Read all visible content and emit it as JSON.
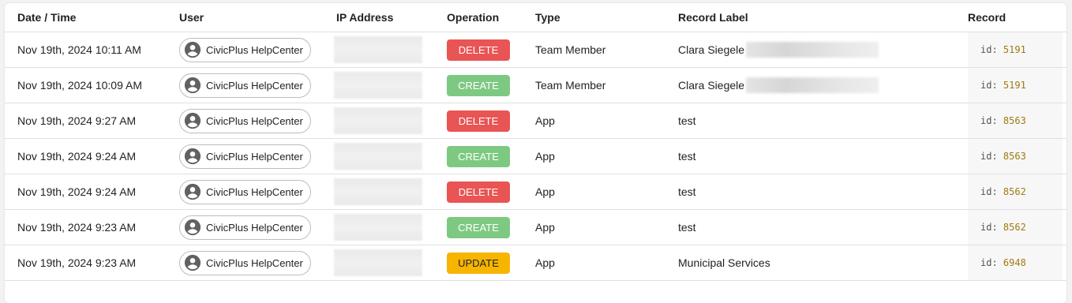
{
  "columns": {
    "date": "Date / Time",
    "user": "User",
    "ip": "IP Address",
    "operation": "Operation",
    "type": "Type",
    "label": "Record Label",
    "record": "Record"
  },
  "colors": {
    "DELETE": "#e85554",
    "CREATE": "#7ec982",
    "UPDATE": "#f7b500"
  },
  "rows": [
    {
      "date": "Nov 19th, 2024 10:11 AM",
      "user": "CivicPlus HelpCenter",
      "operation": "DELETE",
      "type": "Team Member",
      "label": "Clara Siegele",
      "label_redacted": true,
      "record_key": "id:",
      "record_id": "5191"
    },
    {
      "date": "Nov 19th, 2024 10:09 AM",
      "user": "CivicPlus HelpCenter",
      "operation": "CREATE",
      "type": "Team Member",
      "label": "Clara Siegele",
      "label_redacted": true,
      "record_key": "id:",
      "record_id": "5191"
    },
    {
      "date": "Nov 19th, 2024 9:27 AM",
      "user": "CivicPlus HelpCenter",
      "operation": "DELETE",
      "type": "App",
      "label": "test",
      "label_redacted": false,
      "record_key": "id:",
      "record_id": "8563"
    },
    {
      "date": "Nov 19th, 2024 9:24 AM",
      "user": "CivicPlus HelpCenter",
      "operation": "CREATE",
      "type": "App",
      "label": "test",
      "label_redacted": false,
      "record_key": "id:",
      "record_id": "8563"
    },
    {
      "date": "Nov 19th, 2024 9:24 AM",
      "user": "CivicPlus HelpCenter",
      "operation": "DELETE",
      "type": "App",
      "label": "test",
      "label_redacted": false,
      "record_key": "id:",
      "record_id": "8562"
    },
    {
      "date": "Nov 19th, 2024 9:23 AM",
      "user": "CivicPlus HelpCenter",
      "operation": "CREATE",
      "type": "App",
      "label": "test",
      "label_redacted": false,
      "record_key": "id:",
      "record_id": "8562"
    },
    {
      "date": "Nov 19th, 2024 9:23 AM",
      "user": "CivicPlus HelpCenter",
      "operation": "UPDATE",
      "type": "App",
      "label": "Municipal Services",
      "label_redacted": false,
      "record_key": "id:",
      "record_id": "6948"
    }
  ]
}
